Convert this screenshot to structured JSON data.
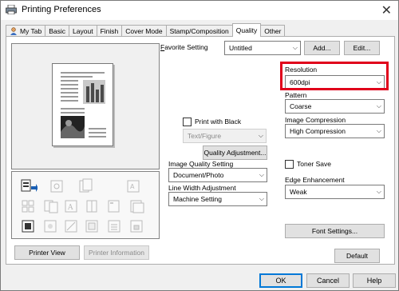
{
  "window": {
    "title": "Printing Preferences",
    "close_glyph": "✕"
  },
  "tabs": [
    {
      "label": "My Tab",
      "active": false
    },
    {
      "label": "Basic",
      "active": false
    },
    {
      "label": "Layout",
      "active": false
    },
    {
      "label": "Finish",
      "active": false
    },
    {
      "label": "Cover Mode",
      "active": false
    },
    {
      "label": "Stamp/Composition",
      "active": false
    },
    {
      "label": "Quality",
      "active": true
    },
    {
      "label": "Other",
      "active": false
    }
  ],
  "favorite": {
    "label_prefix": "F",
    "label_rest": "avorite Setting",
    "value": "Untitled",
    "add_label": "Add...",
    "edit_label": "Edit..."
  },
  "preview": {
    "printer_view": "Printer View",
    "printer_information": "Printer Information"
  },
  "print_with_black": {
    "label": "Print with Black",
    "checked": false,
    "sub_value": "Text/Figure"
  },
  "quality_adjustment_btn": "Quality Adjustment...",
  "image_quality": {
    "label": "Image Quality Setting",
    "value": "Document/Photo"
  },
  "line_width": {
    "label": "Line Width Adjustment",
    "value": "Machine Setting"
  },
  "resolution": {
    "label": "Resolution",
    "value": "600dpi"
  },
  "pattern": {
    "label": "Pattern",
    "value": "Coarse"
  },
  "image_compression": {
    "label": "Image Compression",
    "value": "High Compression"
  },
  "toner_save": {
    "label": "Toner Save",
    "checked": false
  },
  "edge_enhancement": {
    "label": "Edge Enhancement",
    "value": "Weak"
  },
  "font_settings_btn": "Font Settings...",
  "default_btn": "Default",
  "dialog_buttons": {
    "ok": "OK",
    "cancel": "Cancel",
    "help": "Help"
  },
  "colors": {
    "highlight": "#e0001b",
    "focus_border": "#0078d7"
  }
}
